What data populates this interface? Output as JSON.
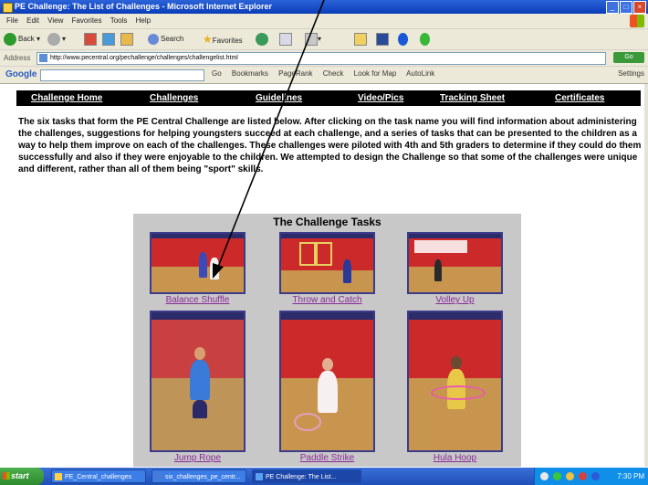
{
  "window": {
    "title": "PE Challenge: The List of Challenges - Microsoft Internet Explorer",
    "controls": [
      "_",
      "□",
      "×"
    ]
  },
  "menu": [
    "File",
    "Edit",
    "View",
    "Favorites",
    "Tools",
    "Help"
  ],
  "toolbar": {
    "back": "Back",
    "search": "Search",
    "favorites": "Favorites"
  },
  "address": {
    "label": "Address",
    "url": "http://www.pecentral.org/pechallenge/challenges/challengelist.html",
    "go": "Go"
  },
  "google_bar": {
    "logo": "Google",
    "items": [
      "Go",
      "Bookmarks",
      "PageRank",
      "Check",
      "Look for Map",
      "AutoLink"
    ],
    "settings": "Settings"
  },
  "nav": [
    "Challenge Home",
    "Challenges",
    "Guidelines",
    "Video/Pics",
    "Tracking Sheet",
    "Certificates"
  ],
  "intro": "The six tasks that form the PE Central Challenge are listed below. After clicking on the task name you will find information about administering the challenges, suggestions for helping youngsters succeed at each challenge, and a series of tasks that can be presented to the children as a way to help them improve on each of the challenges. These challenges were piloted with 4th and 5th graders to determine if they could do them successfully and also if they were enjoyable to the children. We attempted to design the Challenge so that some of the challenges were unique and different, rather than all of them being \"sport\" skills.",
  "tasks_panel": {
    "heading": "The Challenge Tasks",
    "tasks": [
      "Balance Shuffle",
      "Throw and Catch",
      "Volley Up",
      "Jump Rope",
      "Paddle Strike",
      "Hula Hoop"
    ]
  },
  "taskbar": {
    "start": "start",
    "items": [
      "PE_Central_challenges",
      "six_challenges_pe_centr...",
      "PE Challenge: The List..."
    ],
    "clock": "7:30 PM"
  },
  "colors": {
    "nav_bg": "#000000",
    "panel_bg": "#c8c8c8",
    "task_link": "#8a2a9a",
    "gym_wall": "#cc2a2a",
    "gym_floor": "#c8954e"
  }
}
